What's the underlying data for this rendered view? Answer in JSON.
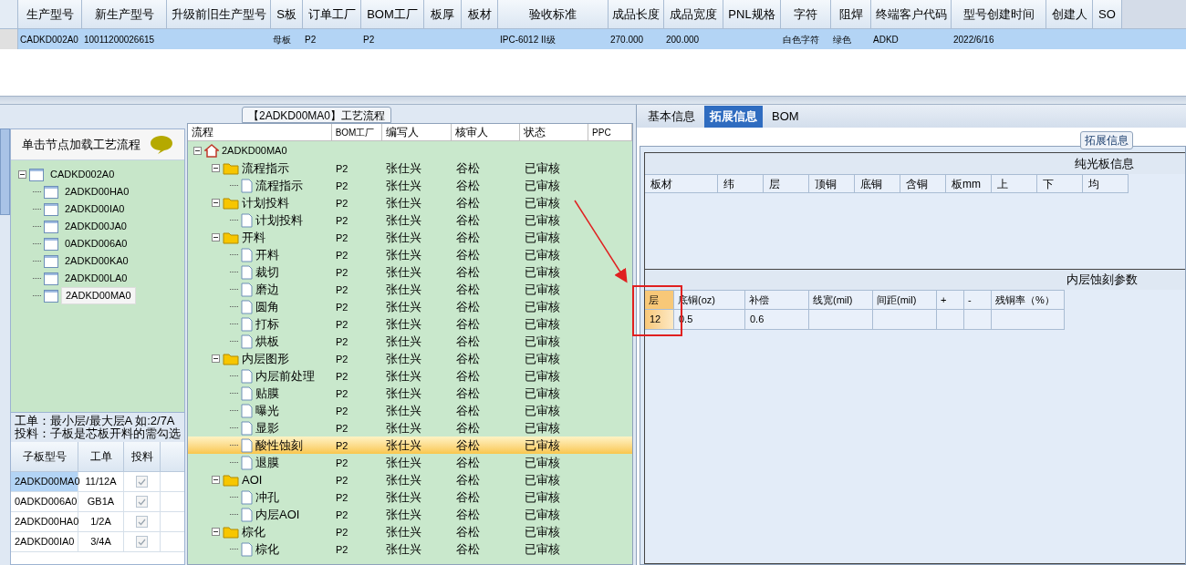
{
  "order_grid": {
    "columns": [
      "生产型号",
      "新生产型号",
      "升级前旧生产型号",
      "S板",
      "订单工厂",
      "BOM工厂",
      "板厚",
      "板材",
      "验收标准",
      "成品长度",
      "成品宽度",
      "PNL规格",
      "字符",
      "阻焊",
      "终端客户代码",
      "型号创建时间",
      "创建人",
      "SO"
    ],
    "rows": [
      {
        "selected": true,
        "cells": [
          "CADKD002A0",
          "10011200026615",
          "",
          "母板",
          "P2",
          "P2",
          "",
          "",
          "IPC-6012 II级",
          "270.000",
          "200.000",
          "",
          "白色字符",
          "绿色",
          "ADKD",
          "2022/6/16",
          "",
          ""
        ]
      }
    ]
  },
  "board_panel": {
    "header": "单击节点加载工艺流程",
    "tree": [
      {
        "label": "CADKD002A0",
        "expanded": true,
        "selected": false,
        "children": [
          {
            "label": "2ADKD00HA0",
            "selected": false
          },
          {
            "label": "2ADKD00IA0",
            "selected": false
          },
          {
            "label": "2ADKD00JA0",
            "selected": false
          },
          {
            "label": "0ADKD006A0",
            "selected": false
          },
          {
            "label": "2ADKD00KA0",
            "selected": false
          },
          {
            "label": "2ADKD00LA0",
            "selected": false
          },
          {
            "label": "2ADKD00MA0",
            "selected": true
          }
        ]
      }
    ],
    "notes": [
      "工单：最小层/最大层A 如:2/7A",
      "投料：子板是芯板开料的需勾选"
    ],
    "sub_boards": {
      "columns": [
        "子板型号",
        "工单",
        "投料"
      ],
      "rows": [
        {
          "model": "2ADKD00MA0",
          "order": "11/12A",
          "checked": true,
          "selected": true
        },
        {
          "model": "0ADKD006A0",
          "order": "GB1A",
          "checked": true,
          "selected": false
        },
        {
          "model": "2ADKD00HA0",
          "order": "1/2A",
          "checked": true,
          "selected": false
        },
        {
          "model": "2ADKD00IA0",
          "order": "3/4A",
          "checked": true,
          "selected": false
        }
      ]
    }
  },
  "process_flow": {
    "title": "【2ADKD00MA0】工艺流程",
    "columns": [
      "流程",
      "BOM工厂",
      "编写人",
      "核审人",
      "状态",
      "PPC"
    ],
    "tree": [
      {
        "label": "2ADKD00MA0",
        "kind": "root",
        "expanded": true,
        "selected": false,
        "children": [
          {
            "label": "流程指示",
            "kind": "folder",
            "expanded": true,
            "selected": false,
            "bom": "P2",
            "writer": "张仕兴",
            "reviewer": "谷松",
            "status": "已审核",
            "children": [
              {
                "label": "流程指示",
                "kind": "step",
                "selected": false,
                "bom": "P2",
                "writer": "张仕兴",
                "reviewer": "谷松",
                "status": "已审核"
              }
            ]
          },
          {
            "label": "计划投料",
            "kind": "folder",
            "expanded": true,
            "selected": false,
            "bom": "P2",
            "writer": "张仕兴",
            "reviewer": "谷松",
            "status": "已审核",
            "children": [
              {
                "label": "计划投料",
                "kind": "step",
                "selected": false,
                "bom": "P2",
                "writer": "张仕兴",
                "reviewer": "谷松",
                "status": "已审核"
              }
            ]
          },
          {
            "label": "开料",
            "kind": "folder",
            "expanded": true,
            "selected": false,
            "bom": "P2",
            "writer": "张仕兴",
            "reviewer": "谷松",
            "status": "已审核",
            "children": [
              {
                "label": "开料",
                "kind": "step",
                "selected": false,
                "bom": "P2",
                "writer": "张仕兴",
                "reviewer": "谷松",
                "status": "已审核"
              },
              {
                "label": "裁切",
                "kind": "step",
                "selected": false,
                "bom": "P2",
                "writer": "张仕兴",
                "reviewer": "谷松",
                "status": "已审核"
              },
              {
                "label": "磨边",
                "kind": "step",
                "selected": false,
                "bom": "P2",
                "writer": "张仕兴",
                "reviewer": "谷松",
                "status": "已审核"
              },
              {
                "label": "圆角",
                "kind": "step",
                "selected": false,
                "bom": "P2",
                "writer": "张仕兴",
                "reviewer": "谷松",
                "status": "已审核"
              },
              {
                "label": "打标",
                "kind": "step",
                "selected": false,
                "bom": "P2",
                "writer": "张仕兴",
                "reviewer": "谷松",
                "status": "已审核"
              },
              {
                "label": "烘板",
                "kind": "step",
                "selected": false,
                "bom": "P2",
                "writer": "张仕兴",
                "reviewer": "谷松",
                "status": "已审核"
              }
            ]
          },
          {
            "label": "内层图形",
            "kind": "folder",
            "expanded": true,
            "selected": false,
            "bom": "P2",
            "writer": "张仕兴",
            "reviewer": "谷松",
            "status": "已审核",
            "children": [
              {
                "label": "内层前处理",
                "kind": "step",
                "selected": false,
                "bom": "P2",
                "writer": "张仕兴",
                "reviewer": "谷松",
                "status": "已审核"
              },
              {
                "label": "贴膜",
                "kind": "step",
                "selected": false,
                "bom": "P2",
                "writer": "张仕兴",
                "reviewer": "谷松",
                "status": "已审核"
              },
              {
                "label": "曝光",
                "kind": "step",
                "selected": false,
                "bom": "P2",
                "writer": "张仕兴",
                "reviewer": "谷松",
                "status": "已审核"
              },
              {
                "label": "显影",
                "kind": "step",
                "selected": false,
                "bom": "P2",
                "writer": "张仕兴",
                "reviewer": "谷松",
                "status": "已审核"
              },
              {
                "label": "酸性蚀刻",
                "kind": "step",
                "selected": true,
                "bom": "P2",
                "writer": "张仕兴",
                "reviewer": "谷松",
                "status": "已审核"
              },
              {
                "label": "退膜",
                "kind": "step",
                "selected": false,
                "bom": "P2",
                "writer": "张仕兴",
                "reviewer": "谷松",
                "status": "已审核"
              }
            ]
          },
          {
            "label": "AOI",
            "kind": "folder",
            "expanded": true,
            "selected": false,
            "bom": "P2",
            "writer": "张仕兴",
            "reviewer": "谷松",
            "status": "已审核",
            "children": [
              {
                "label": "冲孔",
                "kind": "step",
                "selected": false,
                "bom": "P2",
                "writer": "张仕兴",
                "reviewer": "谷松",
                "status": "已审核"
              },
              {
                "label": "内层AOI",
                "kind": "step",
                "selected": false,
                "bom": "P2",
                "writer": "张仕兴",
                "reviewer": "谷松",
                "status": "已审核"
              }
            ]
          },
          {
            "label": "棕化",
            "kind": "folder",
            "expanded": true,
            "selected": false,
            "bom": "P2",
            "writer": "张仕兴",
            "reviewer": "谷松",
            "status": "已审核",
            "children": [
              {
                "label": "棕化",
                "kind": "step",
                "selected": false,
                "bom": "P2",
                "writer": "张仕兴",
                "reviewer": "谷松",
                "status": "已审核"
              }
            ]
          }
        ]
      }
    ]
  },
  "detail_tabs": [
    {
      "label": "基本信息",
      "selected": false
    },
    {
      "label": "拓展信息",
      "selected": true
    },
    {
      "label": "BOM",
      "selected": false
    }
  ],
  "extended_info": {
    "title": "拓展信息",
    "bare_board": {
      "title": "纯光板信息",
      "columns": [
        "板材",
        "纬",
        "层",
        "顶铜",
        "底铜",
        "含铜",
        "板mm",
        "上",
        "下",
        "均"
      ]
    },
    "inner_etch": {
      "title": "内层蚀刻参数",
      "columns": [
        "层",
        "底铜(oz)",
        "补偿",
        "线宽(mil)",
        "间距(mil)",
        "+",
        "-",
        "残铜率（%）"
      ],
      "rows": [
        [
          "12",
          "0.5",
          "0.6",
          "",
          "",
          "",
          "",
          ""
        ]
      ]
    }
  }
}
